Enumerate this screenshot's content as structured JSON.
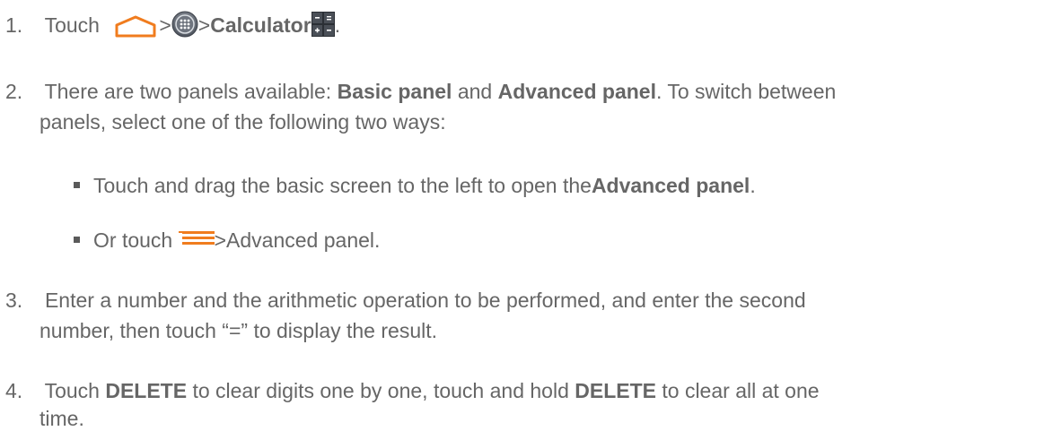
{
  "steps": [
    {
      "number": "1.",
      "touch": "Touch",
      "sep1": ">",
      "sep2": ">",
      "calculator": "Calculator",
      "period": ".",
      "icons": [
        "home-icon",
        "apps-icon",
        "calculator-icon"
      ]
    },
    {
      "number": "2.",
      "text_a": "There are two panels available: ",
      "basic": "Basic panel",
      "and": " and ",
      "advanced": "Advanced panel",
      "text_b": ". To switch between",
      "line2": "panels, select one of the following two ways:",
      "bullets": [
        {
          "text": "Touch and drag the basic screen to the left to open the",
          "bold": "Advanced panel",
          "end": "."
        },
        {
          "text_a": "Or touch ",
          "icon": "menu-icon",
          "text_b": ">Advanced panel."
        }
      ]
    },
    {
      "number": "3.",
      "line1": "Enter a number and the arithmetic operation to be performed, and enter the second",
      "line2": "number, then touch “=” to display the result."
    },
    {
      "number": "4.",
      "a": "Touch ",
      "delete1": "DELETE",
      "b": " to clear digits one by one, touch and hold ",
      "delete2": "DELETE",
      "c": " to clear all at one",
      "line2": "time."
    }
  ],
  "colors": {
    "text": "#666666",
    "home_icon": "#f07c1e",
    "menu_icon": "#f07c1e"
  }
}
